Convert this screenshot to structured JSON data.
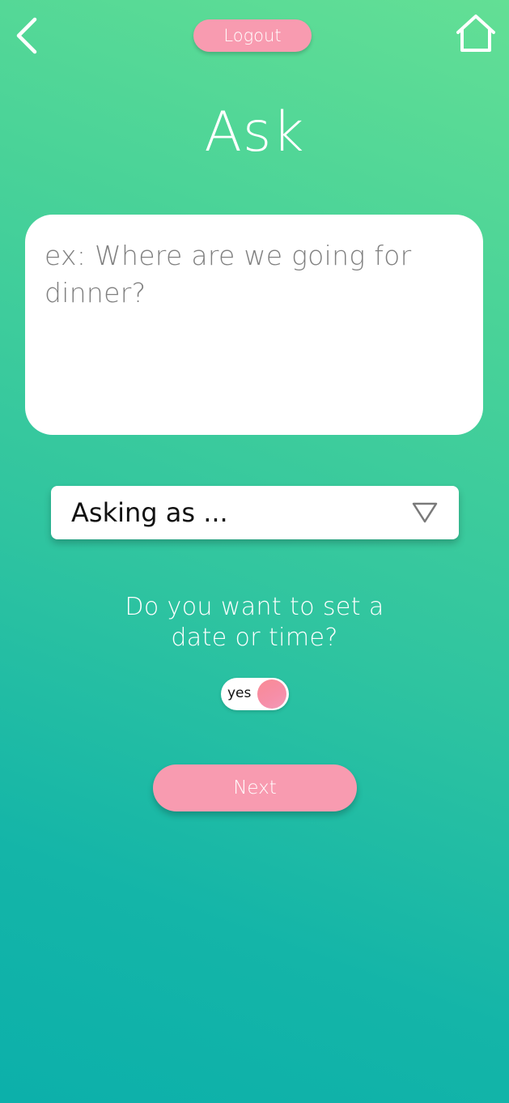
{
  "header": {
    "logout_label": "Logout",
    "back_icon": "chevron-left-icon",
    "home_icon": "home-icon"
  },
  "page": {
    "title": "Ask"
  },
  "question": {
    "placeholder": "ex: Where are we going for dinner?",
    "value": ""
  },
  "asking_as": {
    "label": "Asking as ...",
    "icon": "triangle-down-icon"
  },
  "datetime": {
    "question": "Do you want to set a date or time?",
    "toggle_label": "yes",
    "toggle_on": true
  },
  "actions": {
    "next_label": "Next"
  },
  "colors": {
    "gradient_top": "#63df95",
    "gradient_bottom": "#0cb0aa",
    "button_pink": "#f89bb0",
    "toggle_knob": "#f98a94"
  }
}
